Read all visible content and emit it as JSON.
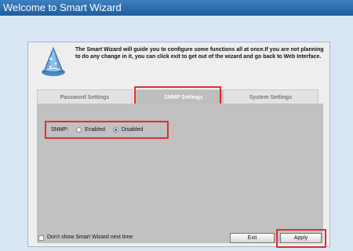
{
  "window": {
    "title": "Welcome to Smart Wizard"
  },
  "intro": {
    "text": "The Smart Wizard will guide you to configure some functions all at once.If you are not planning to do any change in it, you can click exit to get out of the wizard and go back to Web Interface.",
    "icon": "wizard-hat-icon"
  },
  "tabs": [
    {
      "label": "Password Settings",
      "active": false
    },
    {
      "label": "SNMP Settings",
      "active": true
    },
    {
      "label": "System Settings",
      "active": false
    }
  ],
  "snmp": {
    "label": "SNMP:",
    "options": [
      {
        "label": "Enabled",
        "selected": false
      },
      {
        "label": "Disabled",
        "selected": true
      }
    ]
  },
  "footer": {
    "checkbox_label": "Don't show Smart Wizard next time",
    "checkbox_checked": false,
    "exit_label": "Exit",
    "apply_label": "Apply"
  },
  "colors": {
    "title_bar": "#2d6fae",
    "highlight": "#e32d2d",
    "content_bg": "#c1c1c1",
    "window_bg": "#d8e6f3"
  }
}
